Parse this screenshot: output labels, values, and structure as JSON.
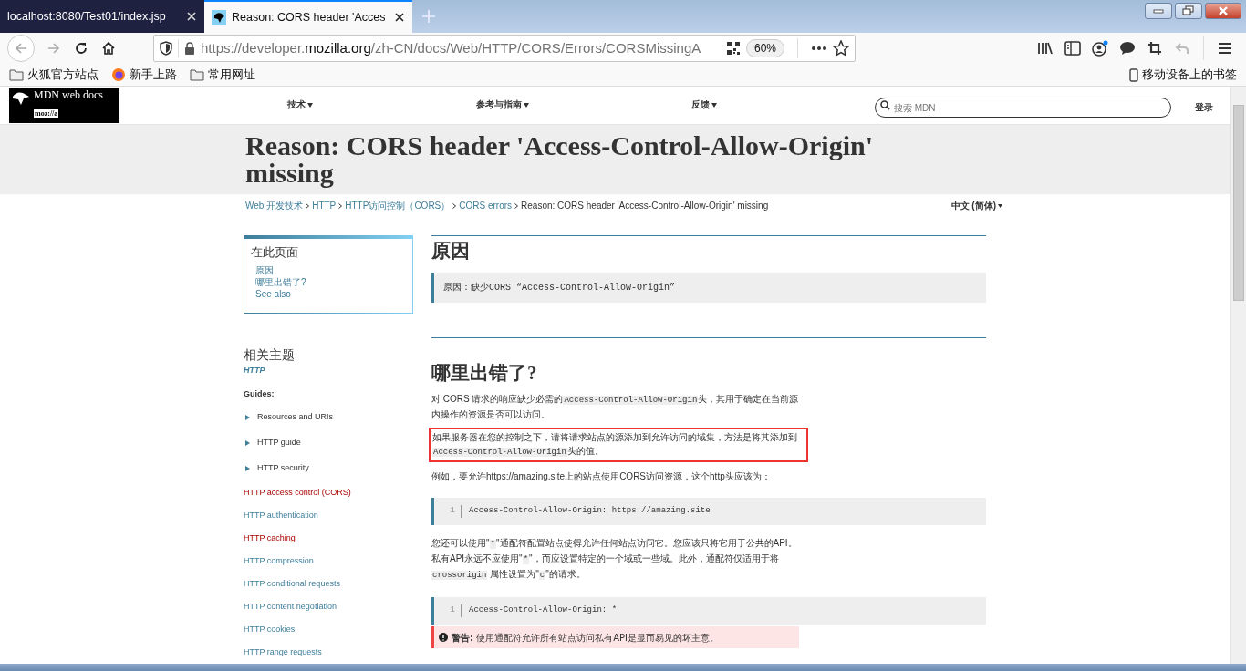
{
  "browser": {
    "tabs": [
      {
        "title": "localhost:8080/Test01/index.jsp",
        "selected": false
      },
      {
        "title": "Reason: CORS header 'Acces",
        "selected": true
      }
    ],
    "url": {
      "prefix": "https://developer.",
      "domain": "mozilla.org",
      "path": "/zh-CN/docs/Web/HTTP/CORS/Errors/CORSMissingA"
    },
    "zoom": "60%",
    "bookmarks": [
      {
        "label": "火狐官方站点",
        "kind": "folder"
      },
      {
        "label": "新手上路",
        "kind": "firefox"
      },
      {
        "label": "常用网址",
        "kind": "folder"
      }
    ],
    "mobile_bookmarks": "移动设备上的书签"
  },
  "site_header": {
    "logo_text": "MDN web docs",
    "logo_sub": "moz://a",
    "nav": [
      "技术",
      "参考与指南",
      "反馈"
    ],
    "search_placeholder": "搜索 MDN",
    "login": "登录"
  },
  "title": "Reason: CORS header 'Access-Control-Allow-Origin' missing",
  "breadcrumbs": [
    "Web 开发技术",
    "HTTP",
    "HTTP访问控制（CORS）",
    "CORS errors",
    "Reason: CORS header 'Access-Control-Allow-Origin' missing"
  ],
  "language": "中文 (简体)",
  "toc": {
    "title": "在此页面",
    "items": [
      "原因",
      "哪里出错了?",
      "See also"
    ]
  },
  "related": {
    "title": "相关主题",
    "subtitle": "HTTP",
    "guides_heading": "Guides:",
    "items": [
      {
        "label": "Resources and URIs",
        "kind": "expandable",
        "visited": false
      },
      {
        "label": "HTTP guide",
        "kind": "expandable",
        "visited": false
      },
      {
        "label": "HTTP security",
        "kind": "expandable",
        "visited": false
      },
      {
        "label": "HTTP access control (CORS)",
        "kind": "link",
        "visited": true
      },
      {
        "label": "HTTP authentication",
        "kind": "link",
        "visited": false
      },
      {
        "label": "HTTP caching",
        "kind": "link",
        "visited": true
      },
      {
        "label": "HTTP compression",
        "kind": "link",
        "visited": false
      },
      {
        "label": "HTTP conditional requests",
        "kind": "link",
        "visited": false
      },
      {
        "label": "HTTP content negotiation",
        "kind": "link",
        "visited": false
      },
      {
        "label": "HTTP cookies",
        "kind": "link",
        "visited": false
      },
      {
        "label": "HTTP range requests",
        "kind": "link",
        "visited": false
      }
    ]
  },
  "content": [
    {
      "kind": "heading",
      "text": "原因"
    },
    {
      "kind": "note",
      "text": "原因：缺少CORS “Access-Control-Allow-Origin”"
    },
    {
      "kind": "heading",
      "text": "哪里出错了?"
    },
    {
      "kind": "paragraph",
      "highlighted": false,
      "parts": [
        {
          "kind": "text",
          "text": "对 CORS 请求的响应缺少必需的"
        },
        {
          "kind": "code",
          "text": "Access-Control-Allow-Origin"
        },
        {
          "kind": "text",
          "text": "头，其用于确定在当前源内操作的资源是否可以访问。"
        }
      ]
    },
    {
      "kind": "paragraph",
      "highlighted": true,
      "parts": [
        {
          "kind": "text",
          "text": "如果服务器在您的控制之下，请将请求站点的源添加到允许访问的域集，方法是将其添加到 "
        },
        {
          "kind": "code",
          "text": "Access-Control-Allow-Origin"
        },
        {
          "kind": "text",
          "text": "头的值。"
        }
      ]
    },
    {
      "kind": "paragraph",
      "highlighted": false,
      "parts": [
        {
          "kind": "text",
          "text": "例如，要允许https://amazing.site上的站点使用CORS访问资源，这个http头应该为："
        }
      ]
    },
    {
      "kind": "code",
      "line": "1",
      "text": "Access-Control-Allow-Origin: https://amazing.site"
    },
    {
      "kind": "paragraph",
      "highlighted": false,
      "parts": [
        {
          "kind": "text",
          "text": "您还可以使用\""
        },
        {
          "kind": "code",
          "text": "*"
        },
        {
          "kind": "text",
          "text": "\"通配符配置站点使得允许任何站点访问它。您应该只将它用于公共的API。私有API永远不应使用\""
        },
        {
          "kind": "code",
          "text": "*"
        },
        {
          "kind": "text",
          "text": "\"，而应设置特定的一个域或一些域。此外，通配符仅适用于将 "
        },
        {
          "kind": "code",
          "text": "crossorigin"
        },
        {
          "kind": "text",
          "text": " 属性设置为\""
        },
        {
          "kind": "code",
          "text": "c"
        },
        {
          "kind": "text",
          "text": "\"的请求。"
        }
      ]
    },
    {
      "kind": "code",
      "line": "1",
      "text": "Access-Control-Allow-Origin: *"
    },
    {
      "kind": "warning",
      "label": "警告:",
      "text": "使用通配符允许所有站点访问私有API是显而易见的坏主意。"
    }
  ]
}
